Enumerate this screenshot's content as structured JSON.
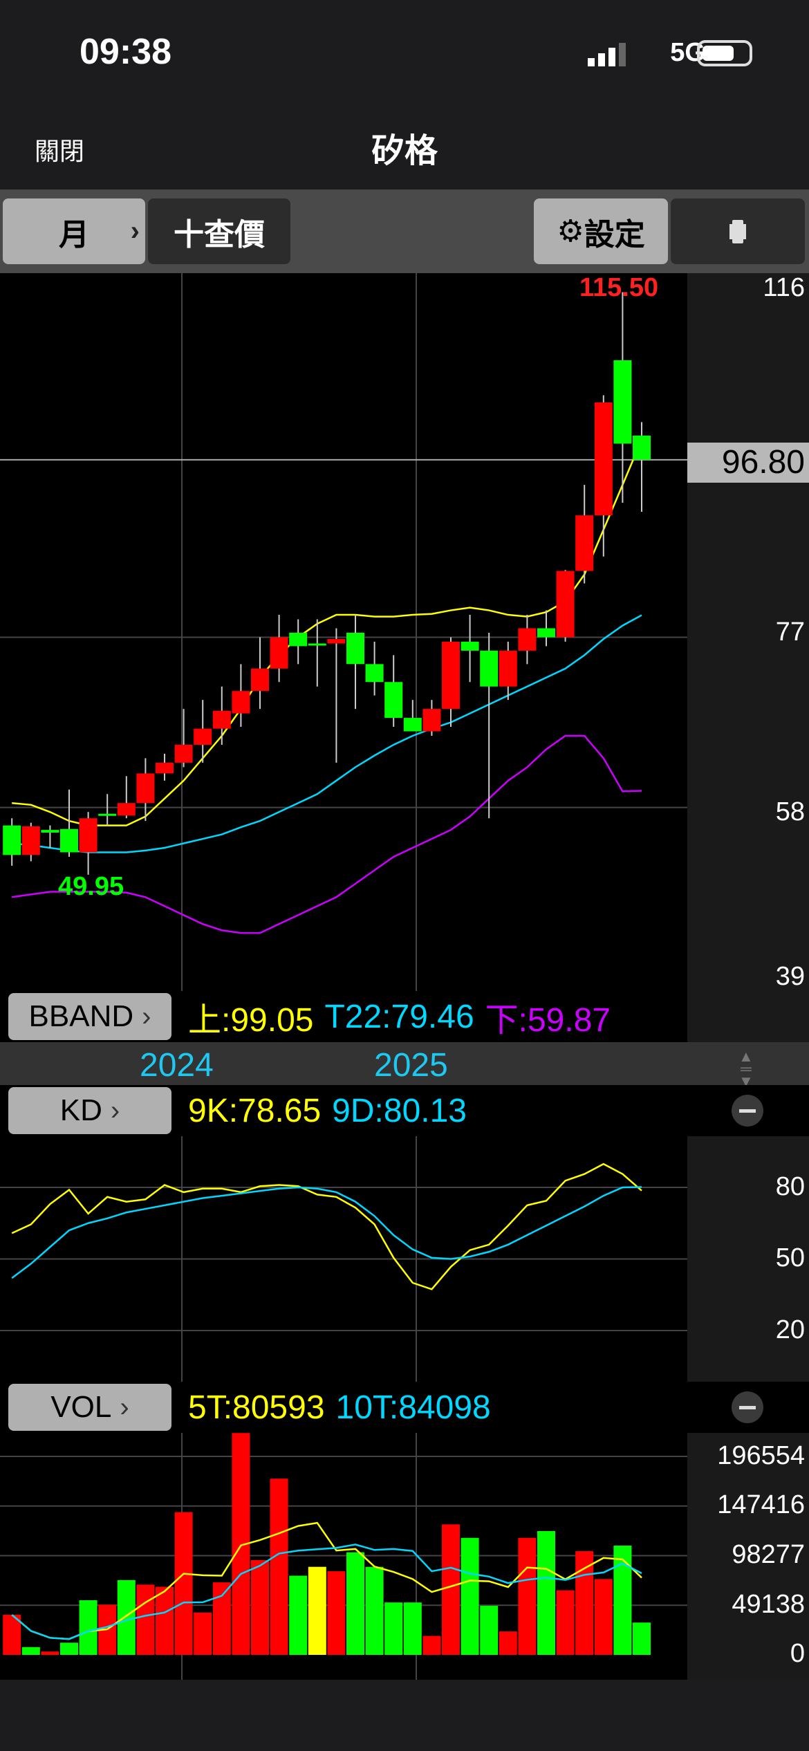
{
  "status": {
    "time": "09:38",
    "network": "5G"
  },
  "nav": {
    "close": "關閉",
    "title": "矽格"
  },
  "toolbar": {
    "period": "月",
    "query": "十查價",
    "settings": "設定",
    "settings_icon": "gear-icon",
    "rotate_icon": "rotate-icon"
  },
  "main": {
    "axis": [
      "116",
      "77",
      "58",
      "39"
    ],
    "current_price": "96.80",
    "max_label": "115.50",
    "min_label": "49.95"
  },
  "bband": {
    "label": "BBAND",
    "upper": "上:99.05",
    "mid": "T22:79.46",
    "lower": "下:59.87"
  },
  "years": [
    "2024",
    "2025"
  ],
  "kd": {
    "label": "KD",
    "k": "9K:78.65",
    "d": "9D:80.13",
    "axis": [
      "80",
      "50",
      "20"
    ]
  },
  "vol": {
    "label": "VOL",
    "ma5": "5T:80593",
    "ma10": "10T:84098",
    "axis": [
      "196554",
      "147416",
      "98277",
      "49138",
      "0"
    ]
  },
  "colors": {
    "up": "#ff0000",
    "down": "#00ff00",
    "flat": "#ffff00",
    "upper": "#ffff00",
    "mid": "#00d8ff",
    "lower": "#cc00ff"
  },
  "chart_data": {
    "type": "candlestick",
    "ohlc": [
      [
        56,
        56.8,
        51.5,
        52.7
      ],
      [
        52.7,
        56.3,
        52,
        55.9
      ],
      [
        55.5,
        56,
        53.5,
        55.2
      ],
      [
        55.6,
        60,
        52.5,
        53
      ],
      [
        53,
        57.5,
        50.5,
        56.8
      ],
      [
        57.3,
        59.5,
        56,
        57.1
      ],
      [
        57.1,
        61.5,
        56.8,
        58.5
      ],
      [
        58.5,
        63.5,
        56.5,
        61.8
      ],
      [
        61.8,
        64,
        61,
        63
      ],
      [
        63,
        69,
        62.5,
        65
      ],
      [
        65,
        70,
        63,
        66.8
      ],
      [
        66.8,
        71.5,
        65,
        68.8
      ],
      [
        68.5,
        74,
        67,
        71
      ],
      [
        71,
        77,
        69,
        73.5
      ],
      [
        73.5,
        79.5,
        72,
        77
      ],
      [
        77.5,
        79,
        74,
        76
      ],
      [
        76.3,
        79,
        71.5,
        76.3
      ],
      [
        76.3,
        78,
        63,
        76.8
      ],
      [
        77.5,
        79.5,
        69,
        74
      ],
      [
        74,
        76.5,
        70.5,
        72
      ],
      [
        72,
        75,
        67,
        68
      ],
      [
        68,
        70,
        66.5,
        66.5
      ],
      [
        66.5,
        70,
        66,
        69
      ],
      [
        69,
        77,
        67,
        76.5
      ],
      [
        76.5,
        79.5,
        72,
        75.5
      ],
      [
        75.5,
        77.5,
        56.8,
        71.5
      ],
      [
        71.5,
        76.5,
        70,
        75.5
      ],
      [
        75.5,
        79.5,
        74,
        78
      ],
      [
        78,
        80,
        76,
        77
      ],
      [
        77,
        84.5,
        76.5,
        84.4
      ],
      [
        84.4,
        94,
        83,
        90.6
      ],
      [
        90.6,
        104,
        86,
        103.2
      ],
      [
        107.9,
        115.5,
        92,
        98.6
      ],
      [
        99.5,
        101,
        91,
        96.8
      ]
    ],
    "bb_upper": [
      58.5,
      58.3,
      57.5,
      56.5,
      56,
      56,
      56,
      57,
      59,
      61,
      63.5,
      66,
      69,
      72.5,
      75,
      77,
      78.5,
      79.5,
      79.5,
      79.3,
      79.3,
      79.5,
      79.6,
      80,
      80.3,
      80,
      79.5,
      79.3,
      79.8,
      81,
      84,
      89,
      94,
      99.05
    ],
    "bb_mid": [
      54,
      53.8,
      53.5,
      53.2,
      53,
      53,
      53,
      53.2,
      53.5,
      54,
      54.5,
      55,
      55.8,
      56.5,
      57.5,
      58.5,
      59.5,
      61,
      62.5,
      63.8,
      65,
      66,
      66.8,
      67.5,
      68.5,
      69.5,
      70.5,
      71.5,
      72.5,
      73.5,
      75,
      76.8,
      78.3,
      79.46
    ],
    "bb_lower": [
      48,
      48.3,
      48.6,
      48.6,
      48.6,
      48.6,
      48.5,
      48,
      47,
      46,
      45,
      44.3,
      44,
      44,
      45,
      46,
      47,
      48,
      49.5,
      51,
      52.5,
      53.5,
      54.5,
      55.5,
      57,
      59,
      61,
      62.5,
      64.5,
      66,
      66,
      63.5,
      59.8,
      59.87
    ],
    "price_range": [
      39,
      116
    ],
    "k": [
      60.8,
      64.5,
      73,
      79,
      69,
      76,
      74,
      75,
      81,
      78,
      79.5,
      79.5,
      78,
      80.5,
      81,
      80.5,
      77,
      76,
      71.5,
      64.5,
      50.5,
      40,
      37.3,
      46.7,
      53.7,
      56,
      64,
      72.5,
      74.4,
      82.8,
      85.6,
      89.8,
      85.6,
      78.65
    ],
    "d": [
      42,
      48,
      55,
      62,
      65,
      67,
      69.5,
      71,
      72.5,
      74,
      75.5,
      76.5,
      77.5,
      78.5,
      79.5,
      80,
      79.5,
      78,
      74,
      68,
      60,
      54,
      50.5,
      50,
      51,
      53,
      56,
      60,
      64,
      68,
      72,
      76.5,
      80,
      80.13
    ],
    "volume": [
      39700,
      7700,
      3300,
      12100,
      54100,
      49700,
      74000,
      69600,
      67400,
      141300,
      42000,
      71800,
      219700,
      93900,
      174500,
      78400,
      87200,
      82800,
      101600,
      87200,
      51900,
      51900,
      18800,
      129200,
      115900,
      48600,
      23200,
      115900,
      122600,
      64000,
      102700,
      75100,
      108200,
      32000
    ],
    "volume_dir": [
      "up",
      "down",
      "up",
      "down",
      "down",
      "up",
      "down",
      "up",
      "up",
      "up",
      "up",
      "up",
      "up",
      "up",
      "up",
      "down",
      "flat",
      "up",
      "down",
      "down",
      "down",
      "down",
      "up",
      "up",
      "down",
      "down",
      "up",
      "up",
      "down",
      "up",
      "up",
      "up",
      "down",
      "down"
    ],
    "vol_max": 196554
  }
}
